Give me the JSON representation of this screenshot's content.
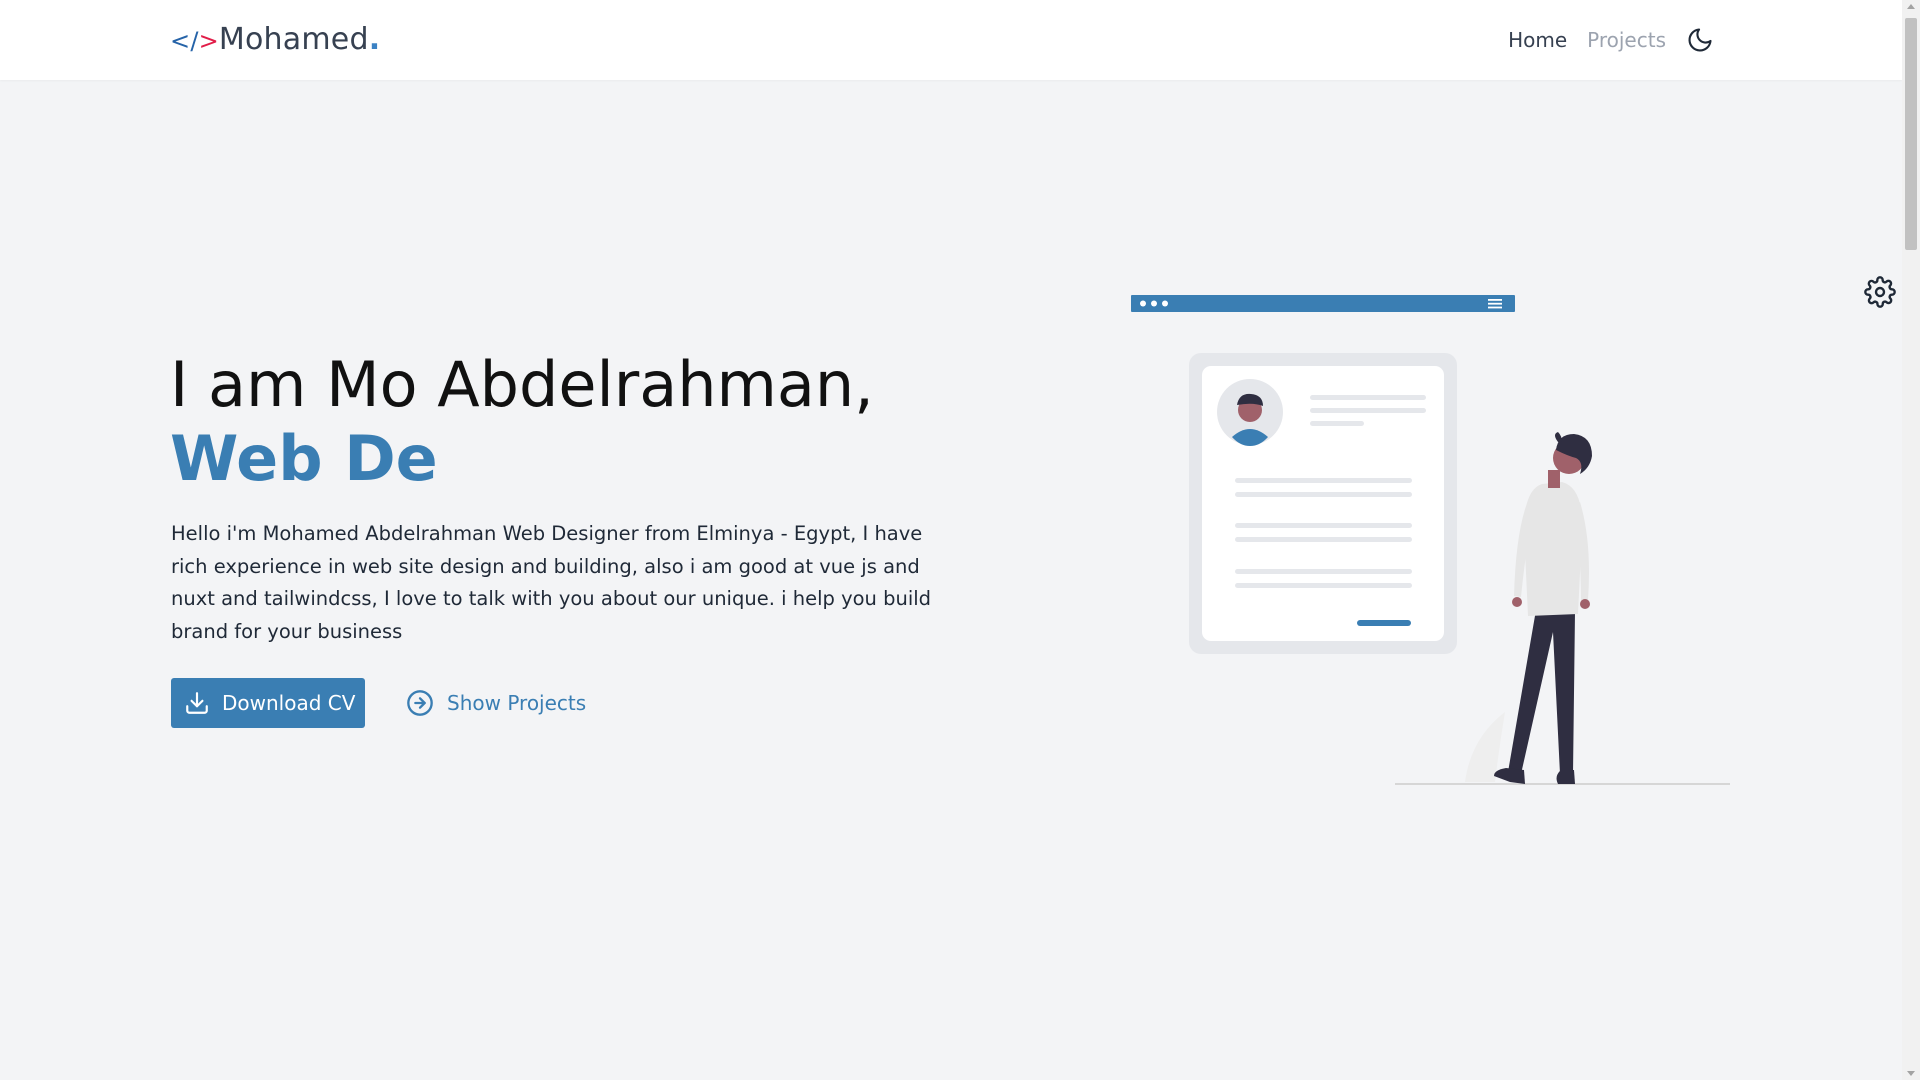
{
  "navbar": {
    "brand": {
      "lt": "<",
      "slash": "/",
      "gt": ">",
      "name": "Mohamed",
      "dot": "."
    },
    "links": [
      {
        "label": "Home"
      },
      {
        "label": "Projects"
      }
    ],
    "theme_toggle_icon": "moon-icon"
  },
  "settings": {
    "icon": "gear-icon"
  },
  "hero": {
    "title": "I am Mo Abdelrahman,",
    "role_typed": "Web De",
    "description": "Hello i'm Mohamed Abdelrahman Web Designer from Elminya - Egypt, I have rich experience in web site design and building, also i am good at vue js and nuxt and tailwindcss, I love to talk with you about our unique. i help you build brand for your business",
    "download_button": {
      "label": "Download CV",
      "icon": "download-icon"
    },
    "projects_button": {
      "label": "Show Projects",
      "icon": "arrow-circle-right-icon"
    }
  },
  "colors": {
    "accent": "#3a7eb3",
    "accent_dark": "#2563a8",
    "brand_gt": "#e11d48",
    "page_bg": "#f3f4f6",
    "text": "#111111"
  }
}
